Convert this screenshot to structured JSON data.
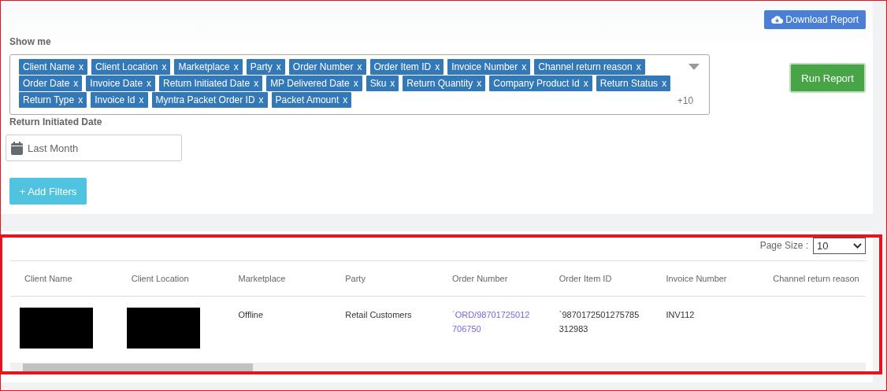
{
  "toolbar": {
    "download_button": "Download Report"
  },
  "show_me": {
    "label": "Show me",
    "tag_rows": [
      [
        {
          "label": "Client Name",
          "remove": "x"
        },
        {
          "label": "Client Location",
          "remove": "x"
        },
        {
          "label": "Marketplace",
          "remove": "x"
        },
        {
          "label": "Party",
          "remove": "x"
        },
        {
          "label": "Order Number",
          "remove": "x"
        },
        {
          "label": "Order Item ID",
          "remove": "x"
        },
        {
          "label": "Invoice Number",
          "remove": "x"
        },
        {
          "label": "Channel return reason",
          "remove": "x"
        }
      ],
      [
        {
          "label": "Order Date",
          "remove": "x"
        },
        {
          "label": "Invoice Date",
          "remove": "x"
        },
        {
          "label": "Return Initiated Date",
          "remove": "x"
        },
        {
          "label": "MP Delivered Date",
          "remove": "x"
        },
        {
          "label": "Sku",
          "remove": "x"
        },
        {
          "label": "Return Quantity",
          "remove": "x"
        },
        {
          "label": "Company Product Id",
          "remove": "x"
        },
        {
          "label": "Return Status",
          "remove": "x"
        }
      ],
      [
        {
          "label": "Return Type",
          "remove": "x"
        },
        {
          "label": "Invoice Id",
          "remove": "x"
        },
        {
          "label": "Myntra Packet Order ID",
          "remove": "x"
        },
        {
          "label": "Packet Amount",
          "remove": "x"
        }
      ]
    ],
    "more_count": "+10"
  },
  "run_button": "Run Report",
  "date_filter": {
    "label": "Return Initiated Date",
    "value": "Last Month"
  },
  "add_filters_button": "+ Add Filters",
  "table": {
    "page_size_label": "Page Size :",
    "page_size": "10",
    "columns": [
      "Client Name",
      "Client Location",
      "Marketplace",
      "Party",
      "Order Number",
      "Order Item ID",
      "Invoice Number",
      "Channel return reason"
    ],
    "rows": [
      {
        "cells": [
          {
            "kind": "redacted"
          },
          {
            "kind": "redacted"
          },
          {
            "kind": "text",
            "lines": [
              "Offline"
            ]
          },
          {
            "kind": "text",
            "lines": [
              "Retail Customers"
            ]
          },
          {
            "kind": "link",
            "lines": [
              "`ORD/98701725012",
              "706750"
            ]
          },
          {
            "kind": "text",
            "lines": [
              "`9870172501275785",
              "312983"
            ]
          },
          {
            "kind": "text",
            "lines": [
              "INV112"
            ]
          }
        ]
      }
    ]
  }
}
